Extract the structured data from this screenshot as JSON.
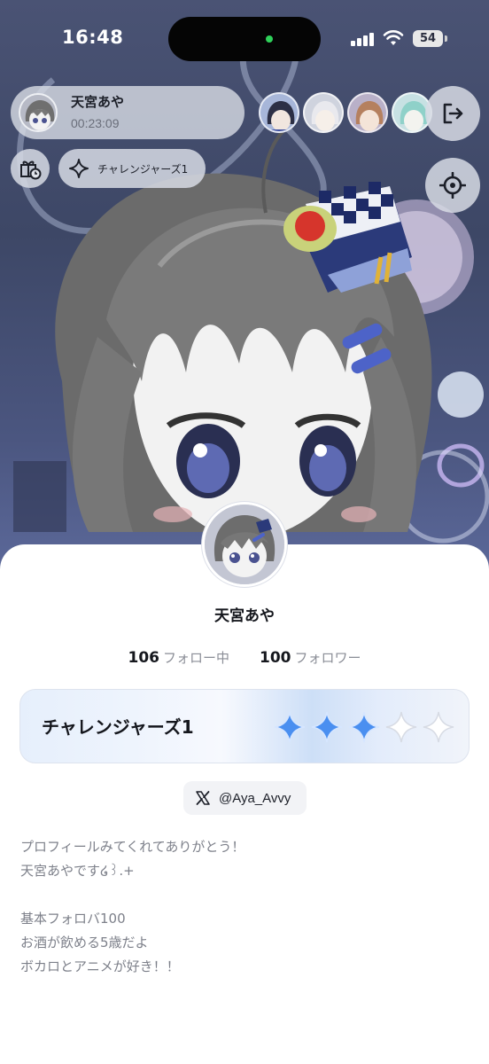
{
  "status_bar": {
    "time": "16:48",
    "battery": "54"
  },
  "live": {
    "host_name": "天宮あや",
    "elapsed": "00:23:09",
    "challenge_label": "チャレンジャーズ1"
  },
  "profile": {
    "name": "天宮あや",
    "following_count": "106",
    "following_label": "フォロー中",
    "followers_count": "100",
    "followers_label": "フォロワー",
    "challenge_title": "チャレンジャーズ1",
    "stars_filled": 3,
    "stars_total": 5,
    "x_handle": "@Aya_Avvy",
    "bio": "プロフィールみてくれてありがとう！\n天宮あやです໒꒱.+\n\n基本フォロバ100\nお酒が飲める5歳だよ\nボカロとアニメが好き！！"
  },
  "colors": {
    "accent_star": "#4a8ff0",
    "island_dot": "#2fd15a"
  },
  "icons": {
    "gift": "gift-clock-icon",
    "challenge": "sparkle-icon",
    "exit": "exit-icon",
    "locate": "crosshair-icon",
    "x": "x-logo-icon"
  }
}
